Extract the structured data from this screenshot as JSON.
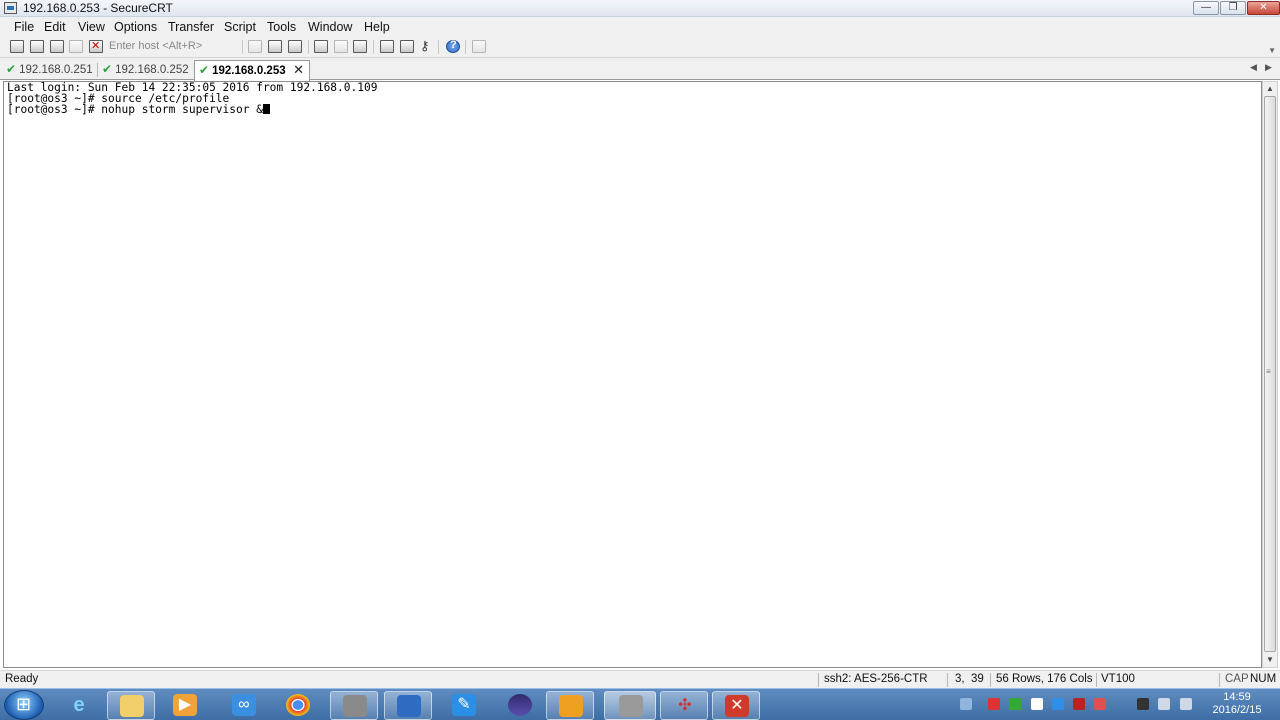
{
  "window": {
    "title": "192.168.0.253 - SecureCRT"
  },
  "menu": [
    "File",
    "Edit",
    "View",
    "Options",
    "Transfer",
    "Script",
    "Tools",
    "Window",
    "Help"
  ],
  "toolbar": {
    "quick_connect_placeholder": "Enter host <Alt+R>"
  },
  "tabs": [
    {
      "label": "192.168.0.251",
      "active": false
    },
    {
      "label": "192.168.0.252",
      "active": false
    },
    {
      "label": "192.168.0.253",
      "active": true
    }
  ],
  "terminal": {
    "lines": [
      "Last login: Sun Feb 14 22:35:05 2016 from 192.168.0.109",
      "[root@os3 ~]# source /etc/profile",
      "[root@os3 ~]# nohup storm supervisor &"
    ]
  },
  "status": {
    "ready": "Ready",
    "cipher": "ssh2: AES-256-CTR",
    "cursor_pos": "3,  39",
    "size": "56 Rows, 176 Cols",
    "term_type": "VT100",
    "caps": "CAP",
    "num": "NUM"
  },
  "taskbar": {
    "time": "14:59",
    "date": "2016/2/15"
  },
  "colors": {
    "tab_check": "#2ea043",
    "taskbar": "#4a78ae"
  }
}
